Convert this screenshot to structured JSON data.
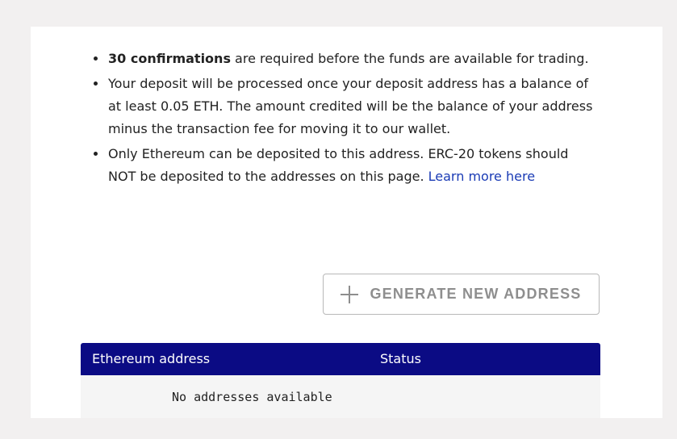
{
  "notes": {
    "item1_bold": "30 confirmations",
    "item1_text": " are required before the funds are available for trading.",
    "item2_text": "Your deposit will be processed once your deposit address has a balance of at least 0.05 ETH. The amount credited will be the balance of your address minus the transaction fee for moving it to our wallet.",
    "item3_text": "Only Ethereum can be deposited to this address. ERC-20 tokens should NOT be deposited to the addresses on this page. ",
    "item3_link": "Learn more here"
  },
  "generate_button": {
    "icon": "plus-icon",
    "label": "GENERATE NEW ADDRESS"
  },
  "table": {
    "headers": [
      "Ethereum address",
      "Status"
    ],
    "empty_message": "No addresses available"
  },
  "colors": {
    "header_bg": "#0b0b84",
    "link": "#1a3bb5",
    "page_bg": "#f2f0f0"
  }
}
